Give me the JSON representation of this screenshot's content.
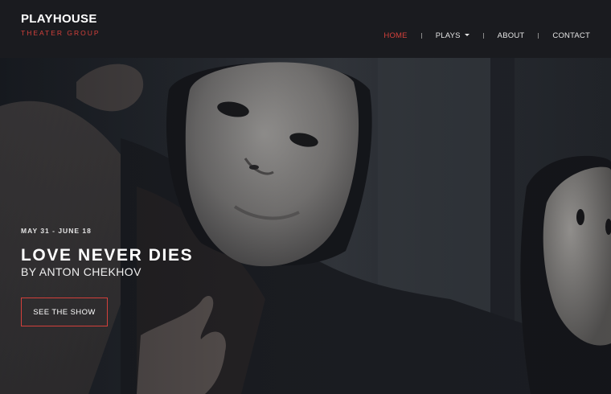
{
  "brand": {
    "name": "PLAYHOUSE",
    "subtitle": "THEATER GROUP"
  },
  "nav": {
    "items": [
      {
        "label": "HOME",
        "active": true
      },
      {
        "label": "PLAYS",
        "dropdown": true
      },
      {
        "label": "ABOUT"
      },
      {
        "label": "CONTACT"
      }
    ]
  },
  "hero": {
    "dates": "MAY 31 - JUNE 18",
    "title": "LOVE NEVER DIES",
    "author": "BY ANTON CHEKHOV",
    "cta_label": "SEE THE SHOW",
    "image_subject": "masked performers photo"
  },
  "colors": {
    "accent": "#d3403b",
    "header_bg": "#1a1b1f",
    "text": "#ffffff"
  }
}
